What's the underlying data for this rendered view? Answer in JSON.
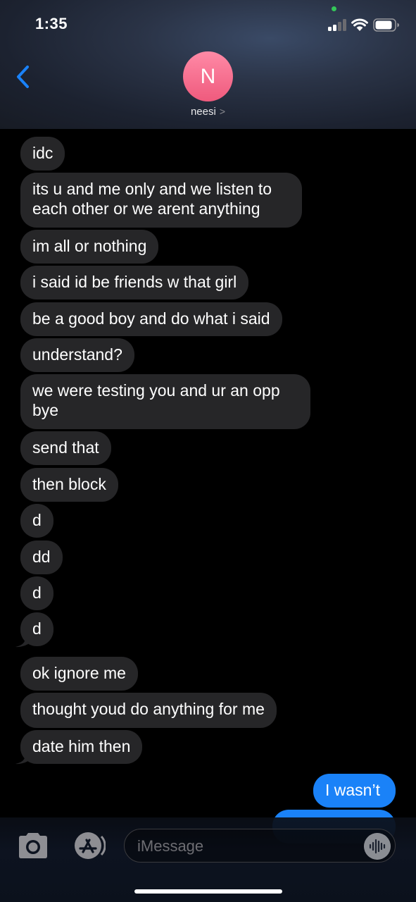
{
  "status_bar": {
    "time": "1:35"
  },
  "header": {
    "avatar_initial": "N",
    "contact_name": "neesi",
    "contact_chevron": ">"
  },
  "messages": [
    {
      "side": "received",
      "text": "idc"
    },
    {
      "side": "received",
      "text": "its u and me only and we listen to each other or we arent anything"
    },
    {
      "side": "received",
      "text": "im all or nothing"
    },
    {
      "side": "received",
      "text": "i said id be friends w that girl"
    },
    {
      "side": "received",
      "text": "be a good boy and do what i said"
    },
    {
      "side": "received",
      "text": "understand?"
    },
    {
      "side": "received",
      "text": "we were testing you and ur an opp bye"
    },
    {
      "side": "received",
      "text": "send that"
    },
    {
      "side": "received",
      "text": "then block"
    },
    {
      "side": "received",
      "text": "d"
    },
    {
      "side": "received",
      "text": "dd"
    },
    {
      "side": "received",
      "text": "d"
    },
    {
      "side": "received",
      "text": "d"
    },
    {
      "side": "received",
      "text": "ok ignore me"
    },
    {
      "side": "received",
      "text": "thought youd do anything for me"
    },
    {
      "side": "received",
      "text": "date him then"
    },
    {
      "side": "sent",
      "text": "I wasn’t"
    }
  ],
  "input_bar": {
    "placeholder": "iMessage",
    "camera_icon": "camera-icon",
    "apps_icon": "app-store-icon",
    "audio_icon": "audio-waveform-icon"
  },
  "colors": {
    "received_bubble": "#262628",
    "sent_bubble": "#1a82f8",
    "avatar": "#ef5a7d",
    "back_chevron": "#1a82f8"
  }
}
